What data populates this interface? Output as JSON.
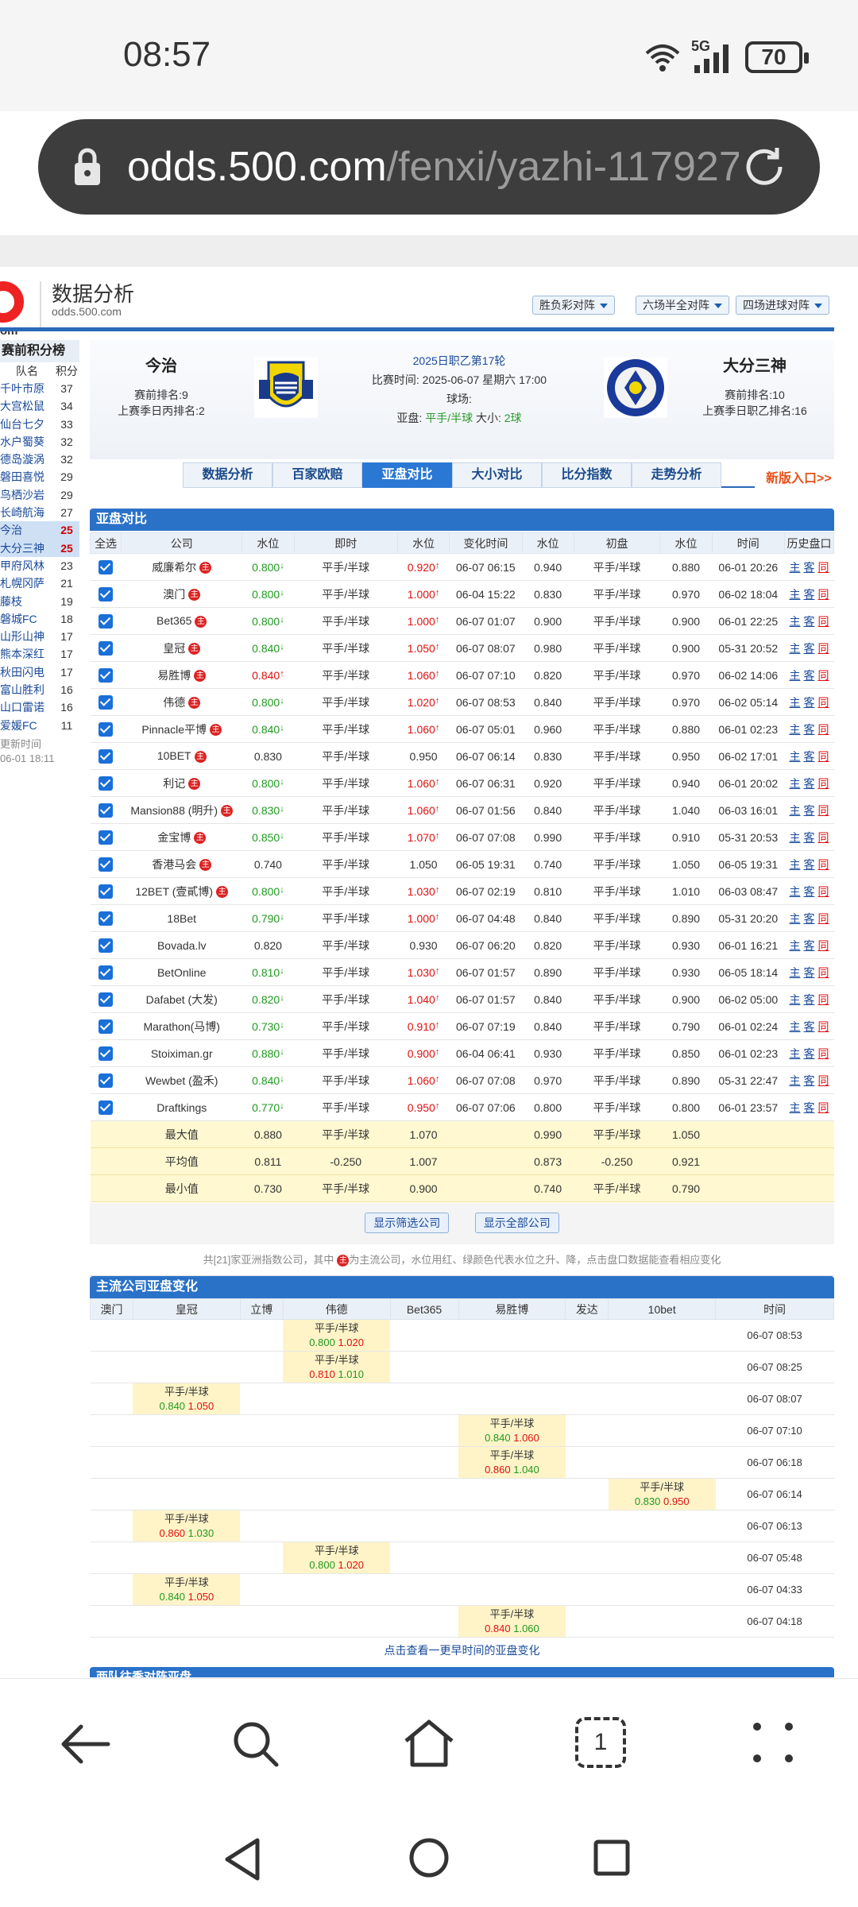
{
  "status_bar": {
    "time": "08:57",
    "network": "5G",
    "battery": "70"
  },
  "browser": {
    "url_host": "odds.500.com",
    "url_path": "/fenxi/yazhi-117927"
  },
  "site": {
    "logo_suffix": "om",
    "name": "数据分析",
    "url": "odds.500.com"
  },
  "top_buttons": [
    "胜负彩对阵",
    "六场半全对阵",
    "四场进球对阵"
  ],
  "sidebar": {
    "title": "赛前积分榜",
    "col_team": "队名",
    "col_points": "积分",
    "rows": [
      {
        "name": "千叶市原",
        "pts": "37"
      },
      {
        "name": "大宫松鼠",
        "pts": "34"
      },
      {
        "name": "仙台七夕",
        "pts": "33"
      },
      {
        "name": "水户蜀葵",
        "pts": "32"
      },
      {
        "name": "德岛漩涡",
        "pts": "32"
      },
      {
        "name": "磐田喜悦",
        "pts": "29"
      },
      {
        "name": "鸟栖沙岩",
        "pts": "29"
      },
      {
        "name": "长崎航海",
        "pts": "27"
      },
      {
        "name": "今治",
        "pts": "25",
        "hl": true
      },
      {
        "name": "大分三神",
        "pts": "25",
        "hl": true
      },
      {
        "name": "甲府风林",
        "pts": "23"
      },
      {
        "name": "札幌冈萨",
        "pts": "21"
      },
      {
        "name": "藤枝",
        "pts": "19"
      },
      {
        "name": "磐城FC",
        "pts": "18"
      },
      {
        "name": "山形山神",
        "pts": "17"
      },
      {
        "name": "熊本深红",
        "pts": "17"
      },
      {
        "name": "秋田闪电",
        "pts": "17"
      },
      {
        "name": "富山胜利",
        "pts": "16"
      },
      {
        "name": "山口雷诺",
        "pts": "16"
      },
      {
        "name": "爱媛FC",
        "pts": "11"
      }
    ],
    "updated_label": "更新时间",
    "updated_time": "06-01 18:11"
  },
  "match": {
    "home": {
      "name": "今治",
      "rank": "赛前排名:9",
      "prev_rank": "上赛季日丙排名:2"
    },
    "away": {
      "name": "大分三神",
      "rank": "赛前排名:10",
      "prev_rank": "上赛季日职乙排名:16"
    },
    "league": "2025日职乙第17轮",
    "time_label": "比赛时间:",
    "time": "2025-06-07 星期六 17:00",
    "venue_label": "球场:",
    "handicap_label": "亚盘:",
    "handicap": "平手/半球",
    "ou_label": "大小:",
    "ou": "2球"
  },
  "tabs": [
    "数据分析",
    "百家欧赔",
    "亚盘对比",
    "大小对比",
    "比分指数",
    "走势分析"
  ],
  "new_link": "新版入口>>",
  "asian": {
    "title": "亚盘对比",
    "headers": [
      "全选",
      "公司",
      "水位",
      "即时",
      "水位",
      "变化时间",
      "水位",
      "初盘",
      "水位",
      "时间",
      "历史盘口"
    ],
    "rows": [
      {
        "co": "威廉希尔",
        "z": true,
        "w1": "0.800",
        "d1": "down",
        "line": "平手/半球",
        "w2": "0.920",
        "d2": "up",
        "t": "06-07 06:15",
        "iw1": "0.940",
        "iline": "平手/半球",
        "iw2": "0.880",
        "it": "06-01 20:26"
      },
      {
        "co": "澳门",
        "z": true,
        "w1": "0.800",
        "d1": "down",
        "line": "平手/半球",
        "w2": "1.000",
        "d2": "up",
        "t": "06-04 15:22",
        "iw1": "0.830",
        "iline": "平手/半球",
        "iw2": "0.970",
        "it": "06-02 18:04"
      },
      {
        "co": "Bet365",
        "z": true,
        "w1": "0.800",
        "d1": "down",
        "line": "平手/半球",
        "w2": "1.000",
        "d2": "up",
        "t": "06-07 01:07",
        "iw1": "0.900",
        "iline": "平手/半球",
        "iw2": "0.900",
        "it": "06-01 22:25"
      },
      {
        "co": "皇冠",
        "z": true,
        "w1": "0.840",
        "d1": "down",
        "line": "平手/半球",
        "w2": "1.050",
        "d2": "up",
        "t": "06-07 08:07",
        "iw1": "0.980",
        "iline": "平手/半球",
        "iw2": "0.900",
        "it": "05-31 20:52"
      },
      {
        "co": "易胜博",
        "z": true,
        "w1": "0.840",
        "d1": "up",
        "line": "平手/半球",
        "w2": "1.060",
        "d2": "up",
        "t": "06-07 07:10",
        "iw1": "0.820",
        "iline": "平手/半球",
        "iw2": "0.970",
        "it": "06-02 14:06"
      },
      {
        "co": "伟德",
        "z": true,
        "w1": "0.800",
        "d1": "down",
        "line": "平手/半球",
        "w2": "1.020",
        "d2": "up",
        "t": "06-07 08:53",
        "iw1": "0.840",
        "iline": "平手/半球",
        "iw2": "0.970",
        "it": "06-02 05:14"
      },
      {
        "co": "Pinnacle平博",
        "z": true,
        "w1": "0.840",
        "d1": "down",
        "line": "平手/半球",
        "w2": "1.060",
        "d2": "up",
        "t": "06-07 05:01",
        "iw1": "0.960",
        "iline": "平手/半球",
        "iw2": "0.880",
        "it": "06-01 02:23"
      },
      {
        "co": "10BET",
        "z": true,
        "w1": "0.830",
        "d1": "",
        "line": "平手/半球",
        "w2": "0.950",
        "d2": "",
        "t": "06-07 06:14",
        "iw1": "0.830",
        "iline": "平手/半球",
        "iw2": "0.950",
        "it": "06-02 17:01"
      },
      {
        "co": "利记",
        "z": true,
        "w1": "0.800",
        "d1": "down",
        "line": "平手/半球",
        "w2": "1.060",
        "d2": "up",
        "t": "06-07 06:31",
        "iw1": "0.920",
        "iline": "平手/半球",
        "iw2": "0.940",
        "it": "06-01 20:02"
      },
      {
        "co": "Mansion88 (明升)",
        "z": true,
        "w1": "0.830",
        "d1": "down",
        "line": "平手/半球",
        "w2": "1.060",
        "d2": "up",
        "t": "06-07 01:56",
        "iw1": "0.840",
        "iline": "平手/半球",
        "iw2": "1.040",
        "it": "06-03 16:01"
      },
      {
        "co": "金宝博",
        "z": true,
        "w1": "0.850",
        "d1": "down",
        "line": "平手/半球",
        "w2": "1.070",
        "d2": "up",
        "t": "06-07 07:08",
        "iw1": "0.990",
        "iline": "平手/半球",
        "iw2": "0.910",
        "it": "05-31 20:53"
      },
      {
        "co": "香港马会",
        "z": true,
        "w1": "0.740",
        "d1": "",
        "line": "平手/半球",
        "w2": "1.050",
        "d2": "",
        "t": "06-05 19:31",
        "iw1": "0.740",
        "iline": "平手/半球",
        "iw2": "1.050",
        "it": "06-05 19:31"
      },
      {
        "co": "12BET (壹貳博)",
        "z": true,
        "w1": "0.800",
        "d1": "down",
        "line": "平手/半球",
        "w2": "1.030",
        "d2": "up",
        "t": "06-07 02:19",
        "iw1": "0.810",
        "iline": "平手/半球",
        "iw2": "1.010",
        "it": "06-03 08:47"
      },
      {
        "co": "18Bet",
        "z": false,
        "w1": "0.790",
        "d1": "down",
        "line": "平手/半球",
        "w2": "1.000",
        "d2": "up",
        "t": "06-07 04:48",
        "iw1": "0.840",
        "iline": "平手/半球",
        "iw2": "0.890",
        "it": "05-31 20:20"
      },
      {
        "co": "Bovada.lv",
        "z": false,
        "w1": "0.820",
        "d1": "",
        "line": "平手/半球",
        "w2": "0.930",
        "d2": "",
        "t": "06-07 06:20",
        "iw1": "0.820",
        "iline": "平手/半球",
        "iw2": "0.930",
        "it": "06-01 16:21"
      },
      {
        "co": "BetOnline",
        "z": false,
        "w1": "0.810",
        "d1": "down",
        "line": "平手/半球",
        "w2": "1.030",
        "d2": "up",
        "t": "06-07 01:57",
        "iw1": "0.890",
        "iline": "平手/半球",
        "iw2": "0.930",
        "it": "06-05 18:14"
      },
      {
        "co": "Dafabet (大发)",
        "z": false,
        "w1": "0.820",
        "d1": "down",
        "line": "平手/半球",
        "w2": "1.040",
        "d2": "up",
        "t": "06-07 01:57",
        "iw1": "0.840",
        "iline": "平手/半球",
        "iw2": "0.900",
        "it": "06-02 05:00"
      },
      {
        "co": "Marathon(马博)",
        "z": false,
        "w1": "0.730",
        "d1": "down",
        "line": "平手/半球",
        "w2": "0.910",
        "d2": "up",
        "t": "06-07 07:19",
        "iw1": "0.840",
        "iline": "平手/半球",
        "iw2": "0.790",
        "it": "06-01 02:24"
      },
      {
        "co": "Stoiximan.gr",
        "z": false,
        "w1": "0.880",
        "d1": "down",
        "line": "平手/半球",
        "w2": "0.900",
        "d2": "up",
        "t": "06-04 06:41",
        "iw1": "0.930",
        "iline": "平手/半球",
        "iw2": "0.850",
        "it": "06-01 02:23"
      },
      {
        "co": "Wewbet (盈禾)",
        "z": false,
        "w1": "0.840",
        "d1": "down",
        "line": "平手/半球",
        "w2": "1.060",
        "d2": "up",
        "t": "06-07 07:08",
        "iw1": "0.970",
        "iline": "平手/半球",
        "iw2": "0.890",
        "it": "05-31 22:47"
      },
      {
        "co": "Draftkings",
        "z": false,
        "w1": "0.770",
        "d1": "down",
        "line": "平手/半球",
        "w2": "0.950",
        "d2": "up",
        "t": "06-07 07:06",
        "iw1": "0.800",
        "iline": "平手/半球",
        "iw2": "0.800",
        "it": "06-01 23:57"
      }
    ],
    "stats": [
      {
        "label": "最大值",
        "w1": "0.880",
        "line": "平手/半球",
        "w2": "1.070",
        "iw1": "0.990",
        "iline": "平手/半球",
        "iw2": "1.050"
      },
      {
        "label": "平均值",
        "w1": "0.811",
        "line": "-0.250",
        "w2": "1.007",
        "iw1": "0.873",
        "iline": "-0.250",
        "iw2": "0.921"
      },
      {
        "label": "最小值",
        "w1": "0.730",
        "line": "平手/半球",
        "w2": "0.900",
        "iw1": "0.740",
        "iline": "平手/半球",
        "iw2": "0.790"
      }
    ],
    "link_home": "主",
    "link_away": "客",
    "link_hist": "同",
    "zhu_icon": "主",
    "btn_filter": "显示筛选公司",
    "btn_all": "显示全部公司",
    "note_pre": "共[21]家亚洲指数公司，其中",
    "note_post": "为主流公司，水位用红、绿颜色代表水位之升、降，点击盘口数据能查看相应变化"
  },
  "changes": {
    "title": "主流公司亚盘变化",
    "headers": [
      "澳门",
      "皇冠",
      "立博",
      "伟德",
      "Bet365",
      "易胜博",
      "发达",
      "10bet",
      "时间"
    ],
    "rows": [
      {
        "col": 3,
        "line": "平手/半球",
        "a": "0.800",
        "ac": "g",
        "b": "1.020",
        "bc": "r",
        "time": "06-07 08:53"
      },
      {
        "col": 3,
        "line": "平手/半球",
        "a": "0.810",
        "ac": "r",
        "b": "1.010",
        "bc": "g",
        "time": "06-07 08:25"
      },
      {
        "col": 1,
        "line": "平手/半球",
        "a": "0.840",
        "ac": "g",
        "b": "1.050",
        "bc": "r",
        "time": "06-07 08:07"
      },
      {
        "col": 5,
        "line": "平手/半球",
        "a": "0.840",
        "ac": "g",
        "b": "1.060",
        "bc": "r",
        "time": "06-07 07:10"
      },
      {
        "col": 5,
        "line": "平手/半球",
        "a": "0.860",
        "ac": "r",
        "b": "1.040",
        "bc": "g",
        "time": "06-07 06:18"
      },
      {
        "col": 7,
        "line": "平手/半球",
        "a": "0.830",
        "ac": "g",
        "b": "0.950",
        "bc": "r",
        "time": "06-07 06:14"
      },
      {
        "col": 1,
        "line": "平手/半球",
        "a": "0.860",
        "ac": "r",
        "b": "1.030",
        "bc": "g",
        "time": "06-07 06:13"
      },
      {
        "col": 3,
        "line": "平手/半球",
        "a": "0.800",
        "ac": "g",
        "b": "1.020",
        "bc": "r",
        "time": "06-07 05:48"
      },
      {
        "col": 1,
        "line": "平手/半球",
        "a": "0.840",
        "ac": "g",
        "b": "1.050",
        "bc": "r",
        "time": "06-07 04:33"
      },
      {
        "col": 5,
        "line": "平手/半球",
        "a": "0.840",
        "ac": "r",
        "b": "1.060",
        "bc": "g",
        "time": "06-07 04:18"
      }
    ],
    "more": "点击查看一更早时间的亚盘变化"
  },
  "next_section": "两队往季对阵亚盘",
  "bottom_nav": [
    "back-icon",
    "search-icon",
    "home-icon",
    "tabs-icon",
    "menu-icon"
  ],
  "tab_count": "1",
  "colors": {
    "accent": "#2a72c8",
    "up": "#e01010",
    "down": "#1f9a1f",
    "stat_bg": "#fff8d0"
  }
}
